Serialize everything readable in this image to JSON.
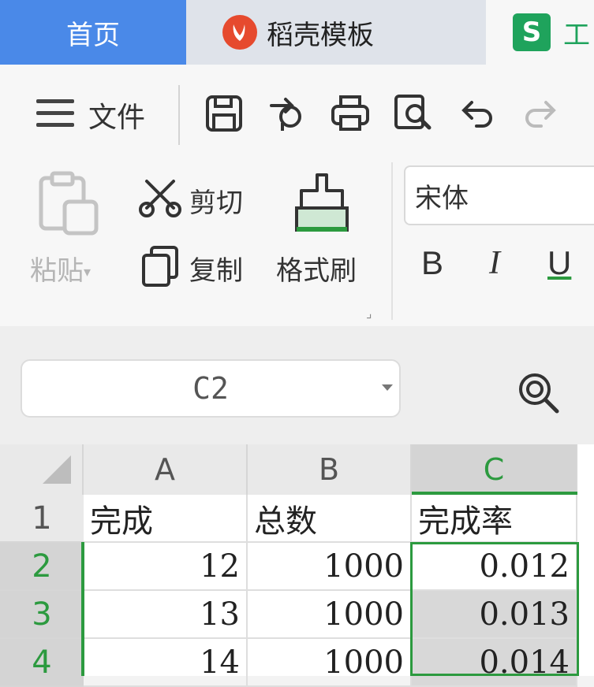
{
  "tabs": {
    "home": "首页",
    "daoke": "稻壳模板",
    "sheet_logo": "S",
    "sheet_title": "工"
  },
  "menu": {
    "label": "文件"
  },
  "quick_access": [
    "save-icon",
    "share-icon",
    "print-icon",
    "print-preview-icon",
    "undo-icon",
    "redo-icon"
  ],
  "clipboard": {
    "paste": "粘贴",
    "cut": "剪切",
    "copy": "复制",
    "format_painter": "格式刷"
  },
  "font": {
    "name": "宋体",
    "bold": "B",
    "italic": "I",
    "underline": "U"
  },
  "name_box": {
    "value": "C2"
  },
  "sheet": {
    "columns": [
      "A",
      "B",
      "C"
    ],
    "rows": [
      {
        "n": "1",
        "cells": [
          "完成",
          "总数",
          "完成率"
        ]
      },
      {
        "n": "2",
        "cells": [
          "12",
          "1000",
          "0.012"
        ]
      },
      {
        "n": "3",
        "cells": [
          "13",
          "1000",
          "0.013"
        ]
      },
      {
        "n": "4",
        "cells": [
          "14",
          "1000",
          "0.014"
        ]
      }
    ]
  },
  "colors": {
    "accent_blue": "#4a89e8",
    "selection_green": "#2c9a3f",
    "daoke_red": "#e64a2e",
    "sheet_green": "#1fa35c"
  }
}
